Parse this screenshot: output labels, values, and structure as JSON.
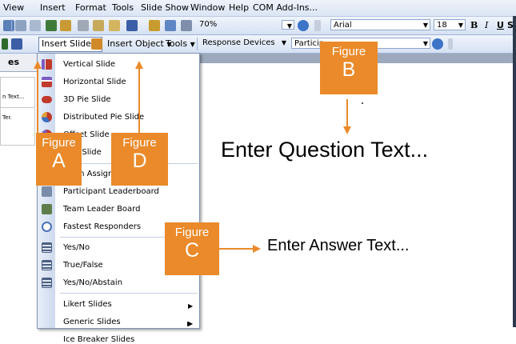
{
  "menubar": {
    "items": [
      "View",
      "Insert",
      "Format",
      "Tools",
      "Slide Show",
      "Window",
      "Help",
      "COM Add-Ins..."
    ]
  },
  "toolbar1": {
    "zoom_value": "70%",
    "font_value": "Arial",
    "size_value": "18",
    "bold_label": "B",
    "italic_label": "I",
    "underline_label": "U",
    "shadow_label": "S"
  },
  "toolbar2": {
    "insert_slide_label": "Insert Slide",
    "insert_object_label": "Insert Object",
    "tools_label": "Tools",
    "response_devices_value": "Response Devices",
    "participants_value": "Particip"
  },
  "left_pane": {
    "tab_label": "es",
    "thumb1_text": "n Text...",
    "thumb2_text": "Ter."
  },
  "insert_slide_menu": {
    "items": [
      {
        "label": "Vertical Slide",
        "icon": "vertical-bar-chart-icon",
        "submenu": false
      },
      {
        "label": "Horizontal Slide",
        "icon": "horizontal-bar-chart-icon",
        "submenu": false
      },
      {
        "label": "3D Pie Slide",
        "icon": "3d-pie-chart-icon",
        "submenu": false
      },
      {
        "label": "Distributed Pie Slide",
        "icon": "pie-chart-icon",
        "submenu": false
      },
      {
        "label": "Offset Slide",
        "icon": "offset-chart-icon",
        "submenu": false
      },
      {
        "label": "Text Slide",
        "icon": "text-slide-icon",
        "submenu": false
      },
      {
        "label": "Team Assignment",
        "icon": "team-icon",
        "submenu": false
      },
      {
        "label": "Participant Leaderboard",
        "icon": "leaderboard-icon",
        "submenu": false
      },
      {
        "label": "Team Leader Board",
        "icon": "team-leader-board-icon",
        "submenu": false
      },
      {
        "label": "Fastest Responders",
        "icon": "stopwatch-icon",
        "submenu": false
      },
      {
        "label": "Yes/No",
        "icon": "list-icon",
        "submenu": false
      },
      {
        "label": "True/False",
        "icon": "list-icon",
        "submenu": false
      },
      {
        "label": "Yes/No/Abstain",
        "icon": "list-icon",
        "submenu": false
      },
      {
        "label": "Likert Slides",
        "icon": "",
        "submenu": true
      },
      {
        "label": "Generic Slides",
        "icon": "",
        "submenu": true
      },
      {
        "label": "Ice Breaker Slides",
        "icon": "",
        "submenu": true
      }
    ]
  },
  "slide": {
    "question_text": "Enter Question Text...",
    "answer_text": "Enter Answer Text..."
  },
  "callouts": {
    "a": {
      "word": "Figure",
      "letter": "A"
    },
    "b": {
      "word": "Figure",
      "letter": "B"
    },
    "c": {
      "word": "Figure",
      "letter": "C"
    },
    "d": {
      "word": "Figure",
      "letter": "D"
    }
  },
  "colors": {
    "callout": "#ea8a2a",
    "menu_border": "#7f93b4",
    "toolbar": "#d5e1f3"
  }
}
